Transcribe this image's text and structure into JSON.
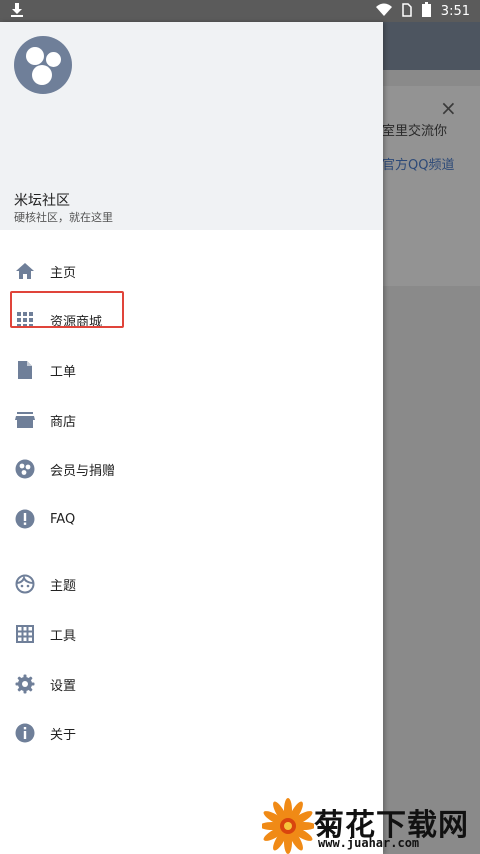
{
  "status_bar": {
    "time": "3:51",
    "icons": [
      "download-icon",
      "wifi-icon",
      "sim-icon",
      "battery-icon"
    ]
  },
  "background": {
    "line1": "室里交流你",
    "line2": "官方QQ频道",
    "close_symbol": "×"
  },
  "drawer": {
    "title": "米坛社区",
    "subtitle": "硬核社区，就在这里",
    "items": [
      {
        "label": "主页",
        "icon": "home-icon"
      },
      {
        "label": "资源商城",
        "icon": "grid-icon"
      },
      {
        "label": "工单",
        "icon": "document-icon"
      },
      {
        "label": "商店",
        "icon": "store-icon"
      },
      {
        "label": "会员与捐赠",
        "icon": "donate-icon"
      },
      {
        "label": "FAQ",
        "icon": "info-exclamation-icon"
      },
      {
        "label": "主题",
        "icon": "face-icon"
      },
      {
        "label": "工具",
        "icon": "table-icon"
      },
      {
        "label": "设置",
        "icon": "gear-icon"
      },
      {
        "label": "关于",
        "icon": "info-icon"
      }
    ]
  },
  "watermark": {
    "text": "菊花下载网",
    "url": "www.juahar.com"
  },
  "colors": {
    "icon": "#6f7f99",
    "highlight": "#e0443a",
    "header_bg": "#f0f2f4"
  }
}
